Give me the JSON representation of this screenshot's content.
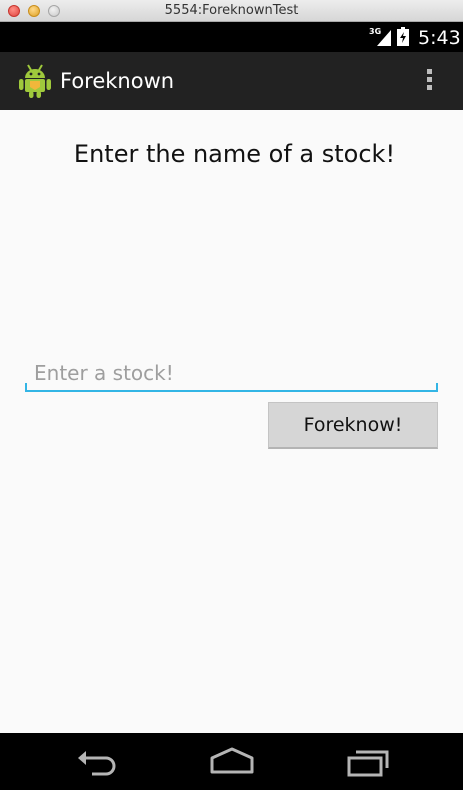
{
  "window": {
    "title": "5554:ForeknownTest"
  },
  "status_bar": {
    "network": "3G",
    "time": "5:43"
  },
  "action_bar": {
    "app_name": "Foreknown",
    "app_icon": "android-robot-icon",
    "menu_icon": "overflow-menu-icon"
  },
  "main": {
    "heading": "Enter the name of a stock!",
    "stock_input": {
      "value": "",
      "placeholder": "Enter a stock!"
    },
    "submit_label": "Foreknow!"
  },
  "nav_bar": {
    "icons": [
      "back-icon",
      "home-icon",
      "recents-icon"
    ]
  },
  "colors": {
    "accent": "#33b5e5",
    "action_bar": "#222222",
    "background": "#fafafa",
    "button": "#d6d6d6"
  }
}
